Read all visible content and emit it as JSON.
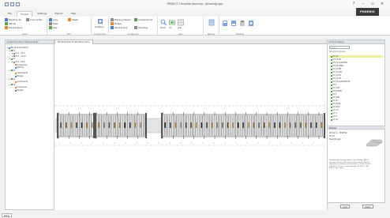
{
  "window": {
    "title": "PROJECT Complete planning - [drawing].ppp",
    "brand": "PHOENIX"
  },
  "ribbon": {
    "tabs": [
      "File",
      "Project",
      "Settings",
      "Export",
      "Help"
    ],
    "groups": [
      {
        "label": "Insert",
        "items": [
          "Mounting rail",
          "DIN rail",
          "Terminal block",
          "Cover profile"
        ]
      },
      {
        "label": "Edit",
        "items": [
          "Copy",
          "Paste",
          "Align",
          "Delete"
        ]
      },
      {
        "label": "Configuration",
        "items": [
          "Configure"
        ]
      },
      {
        "label": "Accessories",
        "items": [
          "Marking material",
          "Bridges",
          "Terminal strip",
          "Accessories list",
          "Test plugs"
        ]
      },
      {
        "label": "View",
        "items": [
          "Zoom",
          "Fit",
          "Grid"
        ]
      },
      {
        "label": "Marking",
        "items": [
          "Marking"
        ]
      },
      {
        "label": "Material",
        "items": [
          "Material"
        ]
      }
    ]
  },
  "left_panel": {
    "header": "Project structure / Terminal strips",
    "tree": [
      {
        "label": "PRJ_Terminal_Project",
        "level": 0,
        "color": "#4a7cc7"
      },
      {
        "label": "X1",
        "level": 1,
        "color": "#5aa34a"
      },
      {
        "label": "X1.1 - X1.6",
        "level": 2,
        "color": "#8c8c8c"
      },
      {
        "label": "X1.7 - X1.12",
        "level": 2,
        "color": "#8c8c8c"
      },
      {
        "label": "X2",
        "level": 1,
        "color": "#5aa34a"
      },
      {
        "label": "X2.1 - X2.8",
        "level": 2,
        "color": "#8c8c8c"
      },
      {
        "label": "Accessories",
        "level": 3,
        "color": "#e28a2b"
      },
      {
        "label": "Marking",
        "level": 3,
        "color": "#4a7cc7"
      },
      {
        "label": "X3",
        "level": 1,
        "color": "#5aa34a"
      },
      {
        "label": "Components",
        "level": 3,
        "color": "#e28a2b"
      },
      {
        "label": "Bridges",
        "level": 3,
        "color": "#4a7cc7"
      },
      {
        "label": "X4",
        "level": 1,
        "color": "#5aa34a"
      },
      {
        "label": "Components",
        "level": 3,
        "color": "#e28a2b"
      },
      {
        "label": "X5",
        "level": 1,
        "color": "#5aa34a"
      },
      {
        "label": "Accessories",
        "level": 3,
        "color": "#e28a2b"
      },
      {
        "label": "Bridges",
        "level": 3,
        "color": "#4a7cc7"
      }
    ]
  },
  "document": {
    "tab_label": "Terminal strip X1 [Mounting rail]",
    "tab_close": "×"
  },
  "right_panel": {
    "header": "Product catalog",
    "search_placeholder": "Search...",
    "filter_label": "All product groups",
    "items": [
      {
        "label": "PT 2,5",
        "selected": true
      },
      {
        "label": "PT 2,5-PE",
        "selected": false
      },
      {
        "label": "PT 2,5-QUATTRO",
        "selected": false
      },
      {
        "label": "PT 2,5-TWIN",
        "selected": false
      },
      {
        "label": "PT 2,5-MT",
        "selected": false
      },
      {
        "label": "PT 2,5-DIO",
        "selected": false
      },
      {
        "label": "PT 2,5-TG",
        "selected": false
      },
      {
        "label": "PT 2,5-PV",
        "selected": false
      },
      {
        "label": "PT 2,5-QUATTRO-PE",
        "selected": false
      },
      {
        "label": "PT 4",
        "selected": false
      },
      {
        "label": "PT 4-PE",
        "selected": false
      },
      {
        "label": "PT 4-TWIN",
        "selected": false
      },
      {
        "label": "PT 6",
        "selected": false
      },
      {
        "label": "PT 6-PE",
        "selected": false
      },
      {
        "label": "PT 10",
        "selected": false
      },
      {
        "label": "PT 10-PE",
        "selected": false
      },
      {
        "label": "PT 16 N",
        "selected": false
      },
      {
        "label": "UT 2,5",
        "selected": false
      },
      {
        "label": "UT 4",
        "selected": false
      },
      {
        "label": "UT 6",
        "selected": false
      },
      {
        "label": "UT 10",
        "selected": false
      }
    ],
    "preview": {
      "header": "Preview",
      "line1": "Article no.: 3209510",
      "line2": "PT 2,5",
      "line3": "Feed-through",
      "description": "Feed-through terminal block, nom. voltage: 800 V, nominal current: 24 A, connection method: Push-in connection, number of connections: 2, cross section: 0.14 mm² - 4 mm², mounting type: NS 35/7.5, NS 35/15, color: gray"
    },
    "buttons": [
      "Insert",
      "Details"
    ]
  },
  "status": {
    "tag": "Ready"
  },
  "colors": {
    "accent": "#4a7cc7",
    "selection": "#f2ef9c",
    "brand_bg": "#3a3a3a"
  }
}
